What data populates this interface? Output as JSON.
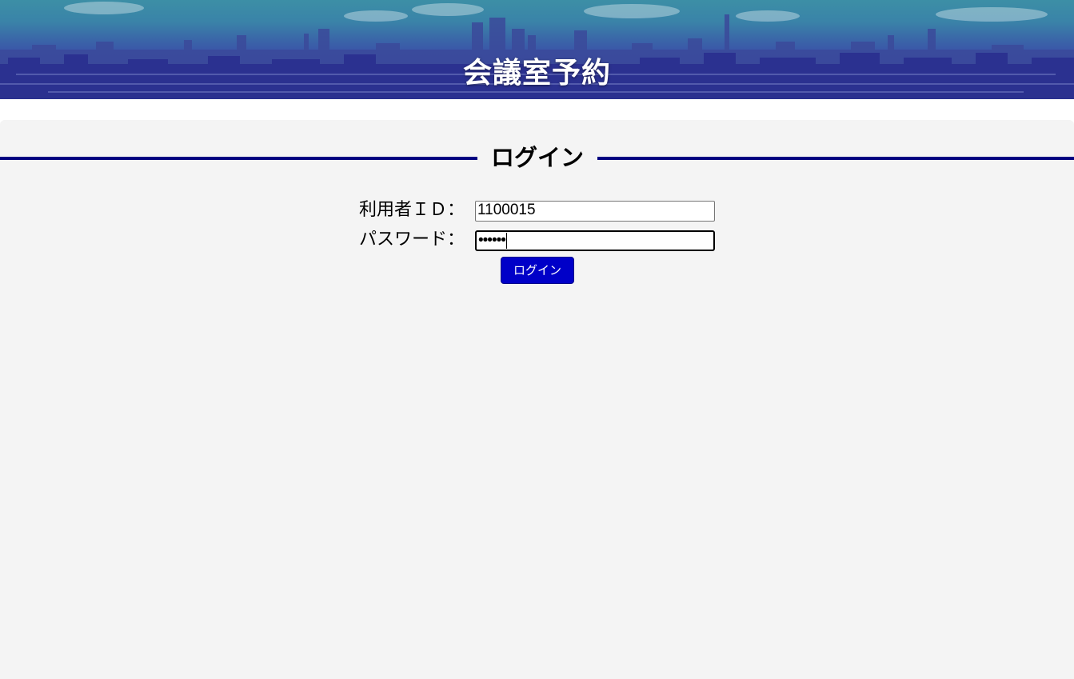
{
  "header": {
    "title": "会議室予約"
  },
  "login": {
    "heading": "ログイン",
    "user_id_label": "利用者ＩＤ：",
    "user_id_value": "1100015",
    "password_label": "パスワード：",
    "password_value": "••••••",
    "submit_label": "ログイン"
  },
  "colors": {
    "accent_rule": "#000080",
    "button": "#0000c8",
    "panel_bg": "#f4f4f4"
  },
  "icons": {
    "header_background": "city-skyline-image"
  }
}
